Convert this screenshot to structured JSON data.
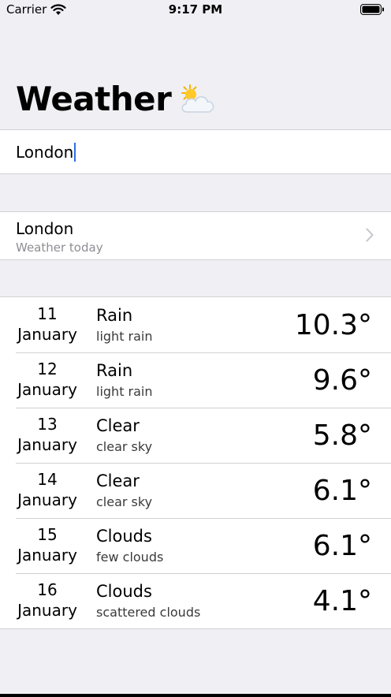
{
  "status": {
    "carrier": "Carrier",
    "time": "9:17 PM"
  },
  "nav": {
    "title": "Weather",
    "title_icon": "sun-behind-cloud-icon"
  },
  "search": {
    "value": "London"
  },
  "city": {
    "name": "London",
    "subtitle": "Weather today"
  },
  "forecast": [
    {
      "day": "11",
      "month": "January",
      "main": "Rain",
      "desc": "light rain",
      "temp": "10.3°"
    },
    {
      "day": "12",
      "month": "January",
      "main": "Rain",
      "desc": "light rain",
      "temp": "9.6°"
    },
    {
      "day": "13",
      "month": "January",
      "main": "Clear",
      "desc": "clear sky",
      "temp": "5.8°"
    },
    {
      "day": "14",
      "month": "January",
      "main": "Clear",
      "desc": "clear sky",
      "temp": "6.1°"
    },
    {
      "day": "15",
      "month": "January",
      "main": "Clouds",
      "desc": "few clouds",
      "temp": "6.1°"
    },
    {
      "day": "16",
      "month": "January",
      "main": "Clouds",
      "desc": "scattered clouds",
      "temp": "4.1°"
    }
  ],
  "colors": {
    "background": "#efeff4",
    "caret": "#2f6fe3",
    "secondary_text": "#8e8e93"
  }
}
